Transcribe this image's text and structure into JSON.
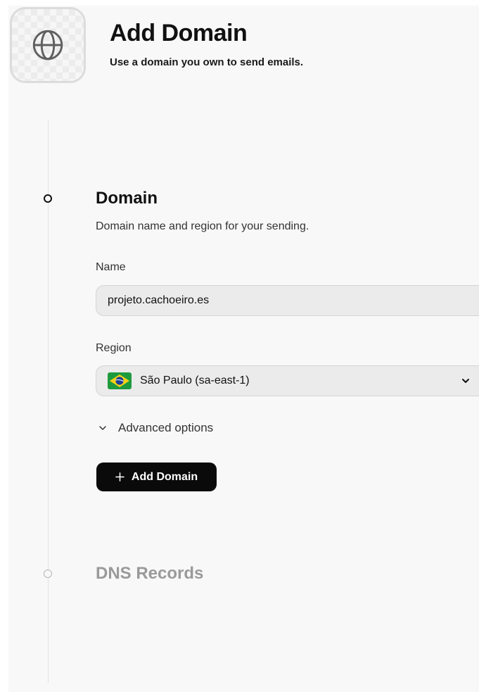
{
  "header": {
    "title": "Add Domain",
    "subtitle": "Use a domain you own to send emails.",
    "icon": "globe-icon"
  },
  "steps": [
    {
      "title": "Domain",
      "description": "Domain name and region for your sending.",
      "state": "active"
    },
    {
      "title": "DNS Records",
      "state": "inactive"
    }
  ],
  "form": {
    "name_label": "Name",
    "name_value": "projeto.cachoeiro.es",
    "region_label": "Region",
    "region_value": "São Paulo (sa-east-1)",
    "region_flag": "brazil-flag-icon",
    "advanced_label": "Advanced options",
    "submit_label": "Add Domain"
  },
  "colors": {
    "button_bg": "#0a0a0a",
    "button_text": "#ffffff",
    "inactive_text": "#9a9a9a",
    "field_bg": "#ebebeb"
  }
}
